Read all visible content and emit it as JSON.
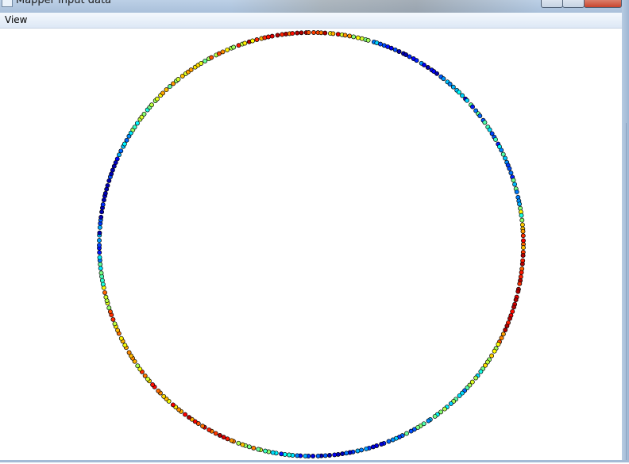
{
  "window": {
    "title": "Mapper input data",
    "icon": "app-window-icon"
  },
  "menu": {
    "items": [
      {
        "label": "View"
      }
    ]
  },
  "scatter": {
    "shape": "ring",
    "colormap": "jet",
    "point_count": 330
  }
}
